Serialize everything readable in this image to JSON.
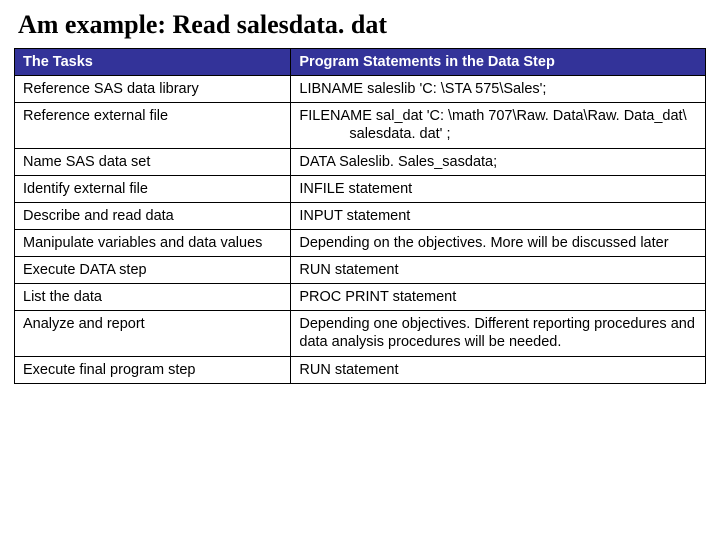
{
  "title": "Am example: Read salesdata. dat",
  "headers": {
    "col1": "The Tasks",
    "col2": "Program Statements in the Data Step"
  },
  "rows": [
    {
      "task": "Reference SAS data library",
      "stmt": "LIBNAME saleslib 'C: \\STA 575\\Sales';"
    },
    {
      "task": "Reference external file",
      "stmt": "FILENAME sal_dat 'C: \\math 707\\Raw. Data\\Raw. Data_dat\\",
      "stmt_cont": "salesdata. dat' ;"
    },
    {
      "task": "Name SAS data set",
      "stmt": "DATA Saleslib. Sales_sasdata;"
    },
    {
      "task": "Identify external file",
      "stmt": "INFILE statement"
    },
    {
      "task": "Describe and read data",
      "stmt": "INPUT statement"
    },
    {
      "task": "Manipulate variables and data values",
      "stmt": "Depending on the objectives. More will be discussed later"
    },
    {
      "task": "Execute DATA step",
      "stmt": "RUN statement"
    },
    {
      "task": "List the data",
      "stmt": "PROC PRINT statement"
    },
    {
      "task": "Analyze and report",
      "stmt": "Depending one objectives. Different reporting procedures and data analysis procedures will be needed."
    },
    {
      "task": "Execute final program step",
      "stmt": "RUN statement"
    }
  ]
}
